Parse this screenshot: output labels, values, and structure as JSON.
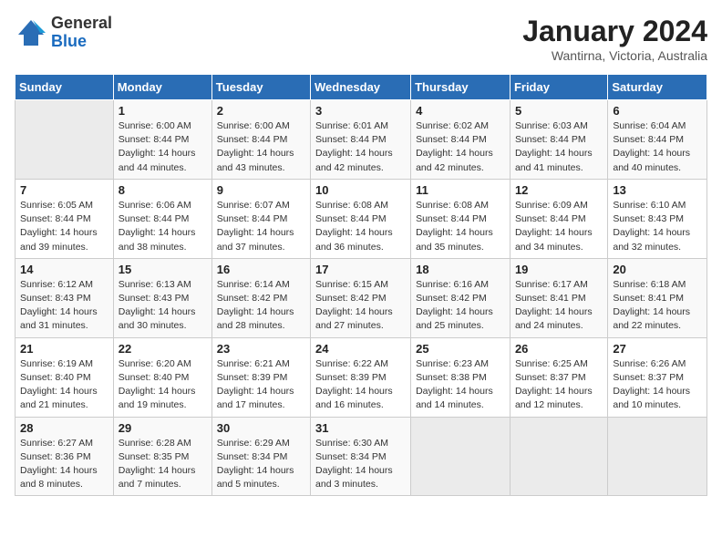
{
  "header": {
    "logo_general": "General",
    "logo_blue": "Blue",
    "month_year": "January 2024",
    "location": "Wantirna, Victoria, Australia"
  },
  "days_of_week": [
    "Sunday",
    "Monday",
    "Tuesday",
    "Wednesday",
    "Thursday",
    "Friday",
    "Saturday"
  ],
  "weeks": [
    [
      {
        "day": "",
        "sunrise": "",
        "sunset": "",
        "daylight": ""
      },
      {
        "day": "1",
        "sunrise": "Sunrise: 6:00 AM",
        "sunset": "Sunset: 8:44 PM",
        "daylight": "Daylight: 14 hours and 44 minutes."
      },
      {
        "day": "2",
        "sunrise": "Sunrise: 6:00 AM",
        "sunset": "Sunset: 8:44 PM",
        "daylight": "Daylight: 14 hours and 43 minutes."
      },
      {
        "day": "3",
        "sunrise": "Sunrise: 6:01 AM",
        "sunset": "Sunset: 8:44 PM",
        "daylight": "Daylight: 14 hours and 42 minutes."
      },
      {
        "day": "4",
        "sunrise": "Sunrise: 6:02 AM",
        "sunset": "Sunset: 8:44 PM",
        "daylight": "Daylight: 14 hours and 42 minutes."
      },
      {
        "day": "5",
        "sunrise": "Sunrise: 6:03 AM",
        "sunset": "Sunset: 8:44 PM",
        "daylight": "Daylight: 14 hours and 41 minutes."
      },
      {
        "day": "6",
        "sunrise": "Sunrise: 6:04 AM",
        "sunset": "Sunset: 8:44 PM",
        "daylight": "Daylight: 14 hours and 40 minutes."
      }
    ],
    [
      {
        "day": "7",
        "sunrise": "Sunrise: 6:05 AM",
        "sunset": "Sunset: 8:44 PM",
        "daylight": "Daylight: 14 hours and 39 minutes."
      },
      {
        "day": "8",
        "sunrise": "Sunrise: 6:06 AM",
        "sunset": "Sunset: 8:44 PM",
        "daylight": "Daylight: 14 hours and 38 minutes."
      },
      {
        "day": "9",
        "sunrise": "Sunrise: 6:07 AM",
        "sunset": "Sunset: 8:44 PM",
        "daylight": "Daylight: 14 hours and 37 minutes."
      },
      {
        "day": "10",
        "sunrise": "Sunrise: 6:08 AM",
        "sunset": "Sunset: 8:44 PM",
        "daylight": "Daylight: 14 hours and 36 minutes."
      },
      {
        "day": "11",
        "sunrise": "Sunrise: 6:08 AM",
        "sunset": "Sunset: 8:44 PM",
        "daylight": "Daylight: 14 hours and 35 minutes."
      },
      {
        "day": "12",
        "sunrise": "Sunrise: 6:09 AM",
        "sunset": "Sunset: 8:44 PM",
        "daylight": "Daylight: 14 hours and 34 minutes."
      },
      {
        "day": "13",
        "sunrise": "Sunrise: 6:10 AM",
        "sunset": "Sunset: 8:43 PM",
        "daylight": "Daylight: 14 hours and 32 minutes."
      }
    ],
    [
      {
        "day": "14",
        "sunrise": "Sunrise: 6:12 AM",
        "sunset": "Sunset: 8:43 PM",
        "daylight": "Daylight: 14 hours and 31 minutes."
      },
      {
        "day": "15",
        "sunrise": "Sunrise: 6:13 AM",
        "sunset": "Sunset: 8:43 PM",
        "daylight": "Daylight: 14 hours and 30 minutes."
      },
      {
        "day": "16",
        "sunrise": "Sunrise: 6:14 AM",
        "sunset": "Sunset: 8:42 PM",
        "daylight": "Daylight: 14 hours and 28 minutes."
      },
      {
        "day": "17",
        "sunrise": "Sunrise: 6:15 AM",
        "sunset": "Sunset: 8:42 PM",
        "daylight": "Daylight: 14 hours and 27 minutes."
      },
      {
        "day": "18",
        "sunrise": "Sunrise: 6:16 AM",
        "sunset": "Sunset: 8:42 PM",
        "daylight": "Daylight: 14 hours and 25 minutes."
      },
      {
        "day": "19",
        "sunrise": "Sunrise: 6:17 AM",
        "sunset": "Sunset: 8:41 PM",
        "daylight": "Daylight: 14 hours and 24 minutes."
      },
      {
        "day": "20",
        "sunrise": "Sunrise: 6:18 AM",
        "sunset": "Sunset: 8:41 PM",
        "daylight": "Daylight: 14 hours and 22 minutes."
      }
    ],
    [
      {
        "day": "21",
        "sunrise": "Sunrise: 6:19 AM",
        "sunset": "Sunset: 8:40 PM",
        "daylight": "Daylight: 14 hours and 21 minutes."
      },
      {
        "day": "22",
        "sunrise": "Sunrise: 6:20 AM",
        "sunset": "Sunset: 8:40 PM",
        "daylight": "Daylight: 14 hours and 19 minutes."
      },
      {
        "day": "23",
        "sunrise": "Sunrise: 6:21 AM",
        "sunset": "Sunset: 8:39 PM",
        "daylight": "Daylight: 14 hours and 17 minutes."
      },
      {
        "day": "24",
        "sunrise": "Sunrise: 6:22 AM",
        "sunset": "Sunset: 8:39 PM",
        "daylight": "Daylight: 14 hours and 16 minutes."
      },
      {
        "day": "25",
        "sunrise": "Sunrise: 6:23 AM",
        "sunset": "Sunset: 8:38 PM",
        "daylight": "Daylight: 14 hours and 14 minutes."
      },
      {
        "day": "26",
        "sunrise": "Sunrise: 6:25 AM",
        "sunset": "Sunset: 8:37 PM",
        "daylight": "Daylight: 14 hours and 12 minutes."
      },
      {
        "day": "27",
        "sunrise": "Sunrise: 6:26 AM",
        "sunset": "Sunset: 8:37 PM",
        "daylight": "Daylight: 14 hours and 10 minutes."
      }
    ],
    [
      {
        "day": "28",
        "sunrise": "Sunrise: 6:27 AM",
        "sunset": "Sunset: 8:36 PM",
        "daylight": "Daylight: 14 hours and 8 minutes."
      },
      {
        "day": "29",
        "sunrise": "Sunrise: 6:28 AM",
        "sunset": "Sunset: 8:35 PM",
        "daylight": "Daylight: 14 hours and 7 minutes."
      },
      {
        "day": "30",
        "sunrise": "Sunrise: 6:29 AM",
        "sunset": "Sunset: 8:34 PM",
        "daylight": "Daylight: 14 hours and 5 minutes."
      },
      {
        "day": "31",
        "sunrise": "Sunrise: 6:30 AM",
        "sunset": "Sunset: 8:34 PM",
        "daylight": "Daylight: 14 hours and 3 minutes."
      },
      {
        "day": "",
        "sunrise": "",
        "sunset": "",
        "daylight": ""
      },
      {
        "day": "",
        "sunrise": "",
        "sunset": "",
        "daylight": ""
      },
      {
        "day": "",
        "sunrise": "",
        "sunset": "",
        "daylight": ""
      }
    ]
  ]
}
